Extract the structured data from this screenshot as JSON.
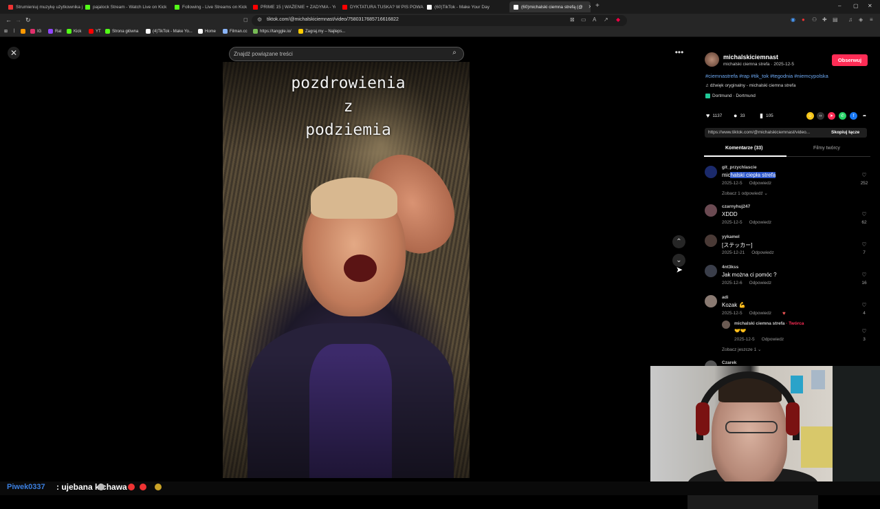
{
  "browser": {
    "tabs": [
      {
        "label": "Strumieniuj muzykę użytkownika jnn",
        "color": "#e33"
      },
      {
        "label": "pajalock Stream - Watch Live on Kick",
        "color": "#53fc18"
      },
      {
        "label": "Following - Live Streams on Kick",
        "color": "#53fc18"
      },
      {
        "label": "PRIME 15 | WAŻENIE + ZADYMA - Yo",
        "color": "#f00"
      },
      {
        "label": "DYKTATURA TUSKA? W PIS POWARI",
        "color": "#f00"
      },
      {
        "label": "(60)TikTok - Make Your Day",
        "color": "#fff"
      },
      {
        "label": "(60)michalski ciemna strefą (@",
        "color": "#fff"
      }
    ],
    "url": "tiktok.com/@michalskiciemnast/video/7580317685716616822",
    "bookmarks": [
      {
        "label": "",
        "color": "#f90"
      },
      {
        "label": "IG",
        "color": "#e1306c"
      },
      {
        "label": "Rat",
        "color": "#9146ff"
      },
      {
        "label": "Kick",
        "color": "#53fc18"
      },
      {
        "label": "YT",
        "color": "#f00"
      },
      {
        "label": "Strona główna",
        "color": "#53fc18"
      },
      {
        "label": "(4)TikTok - Make Yo...",
        "color": "#fff"
      },
      {
        "label": "Home",
        "color": "#fff"
      },
      {
        "label": "Filman.cc",
        "color": "#8ab4f8"
      },
      {
        "label": "https://tanggle.io/",
        "color": "#7b5"
      },
      {
        "label": "Zagraj.my – Najleps...",
        "color": "#fc0"
      }
    ]
  },
  "video": {
    "search_placeholder": "Znajdź powiązane treści",
    "caption_lines": [
      "pozdrowienia",
      "z",
      "podziemia"
    ]
  },
  "post": {
    "username": "michalskiciemnast",
    "subline": "michalski ciemna strefa · 2025-12-5",
    "follow_label": "Obserwuj",
    "hashtags": "#ciemnastrefa #rap #tik_tok #tegodnia #niemcypolska",
    "music": "dźwięk oryginalny - michalski ciemna strefa",
    "location": "Dortmund · Dortmund",
    "likes": "1137",
    "comments": "33",
    "saves": "105",
    "link": "https://www.tiktok.com/@michalskiciemnast/video...",
    "copy_label": "Skopiuj łącze",
    "tab_comments": "Komentarze (33)",
    "tab_videos": "Filmy twórcy"
  },
  "comments": [
    {
      "user": "git_przychlascie",
      "text_pre": "mic",
      "text_hl": "halski ciepła strefa",
      "date": "2025-12-5",
      "reply": "Odpowiedz",
      "likes": "252",
      "more": "Zobacz 1 odpowiedź ⌄",
      "avatar": "#1b2a6b"
    },
    {
      "user": "czarnyhuj247",
      "text": "XDDD",
      "date": "2025-12-5",
      "reply": "Odpowiedz",
      "likes": "62",
      "avatar": "#6b4a52"
    },
    {
      "user": "yykamel",
      "text": "[ステッカー]",
      "date": "2025-12-21",
      "reply": "Odpowiedz",
      "likes": "7",
      "avatar": "#4a3a36"
    },
    {
      "user": "4nt3kss",
      "text": "Jak można ci pomóc ?",
      "date": "2025-12-6",
      "reply": "Odpowiedz",
      "likes": "16",
      "avatar": "#3a3e4a"
    },
    {
      "user": "adi",
      "text": "Kozak 💪",
      "date": "2025-12-5",
      "reply": "Odpowiedz",
      "likes": "4",
      "avatar": "#8a7a72"
    },
    {
      "user": "Czarek",
      "text": "",
      "date": "",
      "reply": "",
      "likes": "",
      "avatar": "#555"
    }
  ],
  "reply": {
    "user": "michalski ciemna strefa",
    "creator_tag": "· Twórca",
    "text": "🤝🤝",
    "date": "2025-12-5",
    "reply": "Odpowiedz",
    "likes": "3",
    "more": "Zobacz jeszcze 1 ⌄"
  },
  "ticker": {
    "name": "Piwek0337",
    "message": ": ujebana kichawa"
  }
}
